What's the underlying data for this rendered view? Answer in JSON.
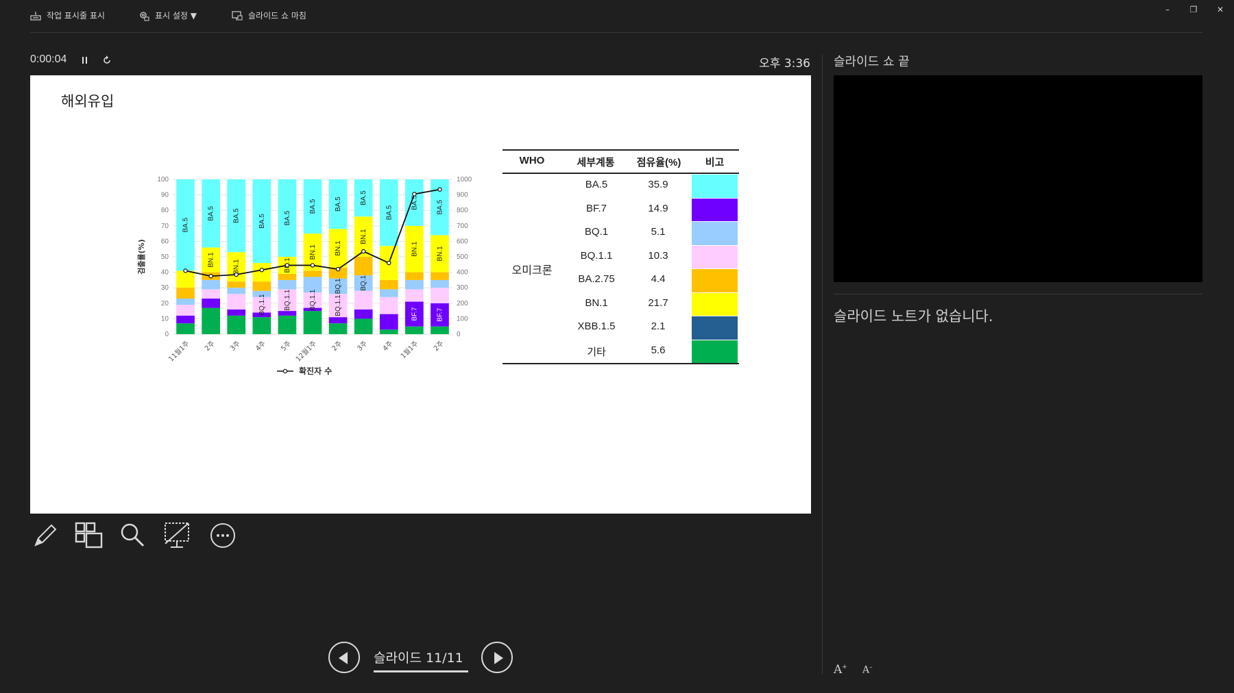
{
  "toolbar": {
    "taskbar_label": "작업 표시줄 표시",
    "display_settings_label": "표시 설정 ▼",
    "end_show_label": "슬라이드 쇼 마침"
  },
  "window": {
    "minimize": "–",
    "restore": "❐",
    "close": "✕"
  },
  "presenter": {
    "elapsed": "0:00:04",
    "clock": "오후 3:36"
  },
  "slide": {
    "title": "해외유입"
  },
  "chart_data": {
    "type": "bar",
    "stacked": true,
    "categories": [
      "11월1주",
      "2주",
      "3주",
      "4주",
      "5주",
      "12월1주",
      "2주",
      "3주",
      "4주",
      "1월1주",
      "2주"
    ],
    "ylabel": "검출률(%)",
    "ylim": [
      0,
      100
    ],
    "y2lim": [
      0,
      1000
    ],
    "yticks": [
      "0",
      "10",
      "20",
      "30",
      "40",
      "50",
      "60",
      "70",
      "80",
      "90",
      "100"
    ],
    "y2ticks": [
      "0",
      "100",
      "200",
      "300",
      "400",
      "500",
      "600",
      "700",
      "800",
      "900",
      "1000"
    ],
    "legend": "확진자 수",
    "legend_position": "bottom",
    "series": [
      {
        "key": "etc",
        "color": "#00b050",
        "values": [
          7,
          17,
          12,
          11,
          12,
          15,
          7,
          10,
          3,
          5,
          5
        ]
      },
      {
        "key": "xbb",
        "color": "#255e91",
        "values": [
          0,
          0,
          0,
          0,
          0,
          0,
          0,
          0,
          0,
          0,
          0
        ]
      },
      {
        "key": "bf7",
        "color": "#6f00ff",
        "values": [
          5,
          6,
          4,
          3,
          3,
          2,
          4,
          6,
          10,
          16,
          15
        ]
      },
      {
        "key": "ba5",
        "color": "#66ffff",
        "values": [
          59,
          44,
          47,
          54,
          50,
          35,
          32,
          24,
          43,
          30,
          36
        ]
      },
      {
        "key": "bq11",
        "color": "#ffccff",
        "values": [
          7,
          6,
          10,
          10,
          14,
          10,
          15,
          12,
          11,
          8,
          10
        ]
      },
      {
        "key": "bq1",
        "color": "#99ccff",
        "values": [
          4,
          6,
          4,
          4,
          6,
          10,
          10,
          10,
          5,
          6,
          5
        ]
      },
      {
        "key": "ba275",
        "color": "#ffc000",
        "values": [
          7,
          5,
          4,
          6,
          4,
          4,
          7,
          12,
          6,
          5,
          5
        ]
      },
      {
        "key": "bn1",
        "color": "#ffff00",
        "values": [
          11,
          16,
          19,
          12,
          11,
          24,
          25,
          26,
          22,
          30,
          24
        ]
      }
    ],
    "stack_order": [
      "etc",
      "xbb",
      "bf7",
      "bq11",
      "bq1",
      "ba275",
      "bn1",
      "ba5"
    ],
    "line_values": [
      410,
      375,
      385,
      415,
      445,
      445,
      420,
      535,
      460,
      905,
      935
    ],
    "bar_labels": [
      {
        "bar": 0,
        "seg": "ba5",
        "text": "BA.5",
        "dark": false
      },
      {
        "bar": 1,
        "seg": "ba5",
        "text": "BA.5",
        "dark": false
      },
      {
        "bar": 1,
        "seg": "bn1",
        "text": "BN.1",
        "dark": false
      },
      {
        "bar": 2,
        "seg": "ba5",
        "text": "BA.5",
        "dark": false
      },
      {
        "bar": 2,
        "seg": "bn1",
        "text": "BN.1",
        "dark": false
      },
      {
        "bar": 3,
        "seg": "ba5",
        "text": "BA.5",
        "dark": false
      },
      {
        "bar": 3,
        "seg": "bq11",
        "text": "BQ.1.1",
        "dark": false
      },
      {
        "bar": 4,
        "seg": "ba5",
        "text": "BA.5",
        "dark": false
      },
      {
        "bar": 4,
        "seg": "bn1",
        "text": "BN.1",
        "dark": false
      },
      {
        "bar": 4,
        "seg": "bq11",
        "text": "BQ.1.1",
        "dark": false
      },
      {
        "bar": 5,
        "seg": "ba5",
        "text": "BA.5",
        "dark": false
      },
      {
        "bar": 5,
        "seg": "bn1",
        "text": "BN.1",
        "dark": false
      },
      {
        "bar": 5,
        "seg": "bq11",
        "text": "BQ.1.1",
        "dark": false
      },
      {
        "bar": 6,
        "seg": "ba5",
        "text": "BA.5",
        "dark": false
      },
      {
        "bar": 6,
        "seg": "bn1",
        "text": "BN.1",
        "dark": false
      },
      {
        "bar": 6,
        "seg": "bq1",
        "text": "BQ.1",
        "dark": false
      },
      {
        "bar": 6,
        "seg": "bq11",
        "text": "BQ.1.1",
        "dark": false
      },
      {
        "bar": 7,
        "seg": "ba5",
        "text": "BA.5",
        "dark": false
      },
      {
        "bar": 7,
        "seg": "bn1",
        "text": "BN.1",
        "dark": false
      },
      {
        "bar": 7,
        "seg": "bq1",
        "text": "BQ.1",
        "dark": false
      },
      {
        "bar": 8,
        "seg": "ba5",
        "text": "BA.5",
        "dark": false
      },
      {
        "bar": 9,
        "seg": "ba5",
        "text": "BA.5",
        "dark": false
      },
      {
        "bar": 9,
        "seg": "bn1",
        "text": "BN.1",
        "dark": false
      },
      {
        "bar": 9,
        "seg": "bf7",
        "text": "BF.7",
        "dark": true
      },
      {
        "bar": 10,
        "seg": "ba5",
        "text": "BA.5",
        "dark": false
      },
      {
        "bar": 10,
        "seg": "bn1",
        "text": "BN.1",
        "dark": false
      },
      {
        "bar": 10,
        "seg": "bf7",
        "text": "BF.7",
        "dark": true
      }
    ]
  },
  "table": {
    "headers": [
      "WHO",
      "세부계통",
      "점유율(%)",
      "비고"
    ],
    "group": "오미크론",
    "rows": [
      {
        "name": "BA.5",
        "share": "35.9",
        "color": "#66ffff"
      },
      {
        "name": "BF.7",
        "share": "14.9",
        "color": "#6f00ff"
      },
      {
        "name": "BQ.1",
        "share": "5.1",
        "color": "#99ccff"
      },
      {
        "name": "BQ.1.1",
        "share": "10.3",
        "color": "#ffccff"
      },
      {
        "name": "BA.2.75",
        "share": "4.4",
        "color": "#ffc000"
      },
      {
        "name": "BN.1",
        "share": "21.7",
        "color": "#ffff00"
      },
      {
        "name": "XBB.1.5",
        "share": "2.1",
        "color": "#255e91"
      },
      {
        "name": "기타",
        "share": "5.6",
        "color": "#00b050"
      }
    ]
  },
  "navigation": {
    "label": "슬라이드 11/11"
  },
  "next_slide": {
    "label": "슬라이드 쇼 끝"
  },
  "notes": {
    "text": "슬라이드 노트가 없습니다."
  },
  "font_controls": {
    "increase": "A",
    "decrease": "A"
  }
}
